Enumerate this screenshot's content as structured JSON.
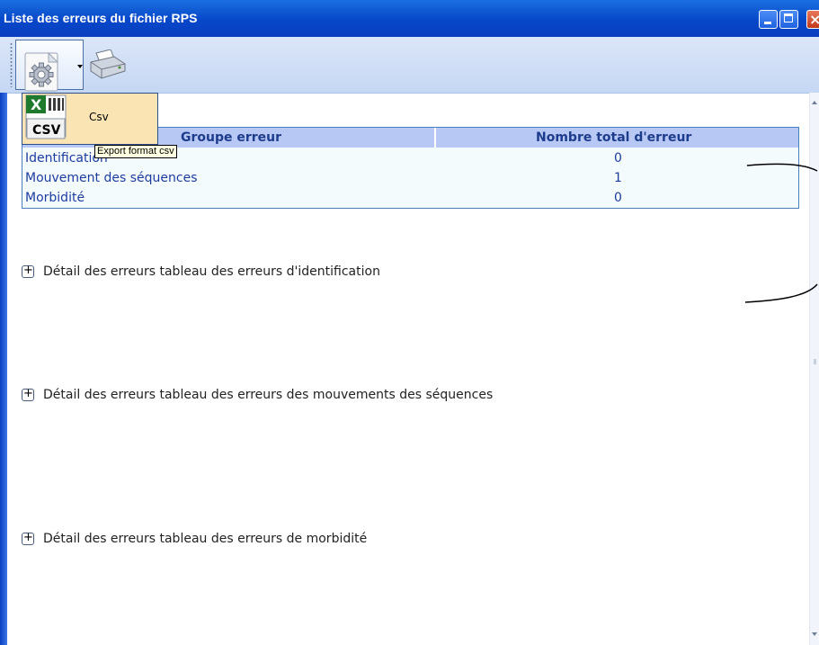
{
  "window": {
    "title": "Liste des erreurs du fichier RPS",
    "controls": [
      "minimize",
      "maximize",
      "close"
    ]
  },
  "toolbar": {
    "settings_button": {
      "icon": "gear-icon",
      "has_dropdown": true
    },
    "print_button": {
      "icon": "printer-icon"
    }
  },
  "dropdown_menu": {
    "items": [
      {
        "label": "Csv",
        "icon": "csv-file-icon",
        "icon_text": "CSV"
      }
    ],
    "tooltip": "Export format csv"
  },
  "summary_table": {
    "columns": [
      "Groupe erreur",
      "Nombre total d'erreur"
    ],
    "rows": [
      {
        "group": "Identification",
        "count": "0"
      },
      {
        "group": "Mouvement des séquences",
        "count": "1"
      },
      {
        "group": "Morbidité",
        "count": "0"
      }
    ]
  },
  "sections": [
    {
      "expander": "+",
      "label": "Détail des erreurs tableau des erreurs d'identification"
    },
    {
      "expander": "+",
      "label": "Détail des erreurs tableau des erreurs des mouvements des séquences"
    },
    {
      "expander": "+",
      "label": "Détail des erreurs tableau des erreurs de morbidité"
    }
  ],
  "colors": {
    "title_bar": "#0747c9",
    "toolbar": "#c5d7f3",
    "table_header": "#b7c8f5",
    "table_border": "#4a7dbb",
    "link_text": "#1e3ca0",
    "popup_bg": "#fbe4b4",
    "tooltip_bg": "#ffffe1"
  }
}
